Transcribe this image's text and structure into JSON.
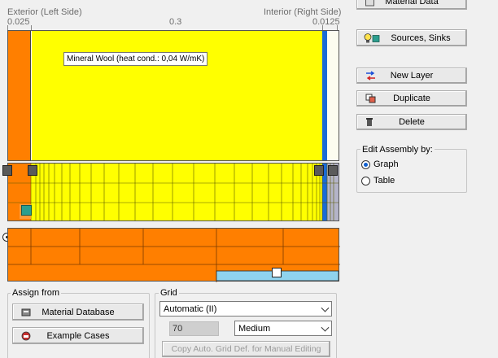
{
  "header": {
    "left_label": "Exterior (Left Side)",
    "right_label": "Interior (Right Side)",
    "tick_left": "0.025",
    "tick_mid": "0.3",
    "tick_right": "0.0125"
  },
  "tooltip": "Mineral Wool (heat cond.: 0,04 W/mK)",
  "buttons": {
    "material_data": "Material Data",
    "sources_sinks": "Sources, Sinks",
    "new_layer": "New Layer",
    "duplicate": "Duplicate",
    "delete": "Delete"
  },
  "edit_assembly": {
    "title": "Edit Assembly by:",
    "options": [
      "Graph",
      "Table"
    ],
    "selected": "Graph"
  },
  "assign": {
    "title": "Assign from",
    "material_database": "Material Database",
    "example_cases": "Example Cases"
  },
  "grid": {
    "title": "Grid",
    "mode": "Automatic (II)",
    "count": "70",
    "density": "Medium",
    "copy_label": "Copy Auto. Grid Def. for Manual Editing"
  },
  "colors": {
    "orange": "#ff7f00",
    "yellow": "#ffff00",
    "blue": "#1a6bd6",
    "light_blue": "#8fd3ee"
  }
}
